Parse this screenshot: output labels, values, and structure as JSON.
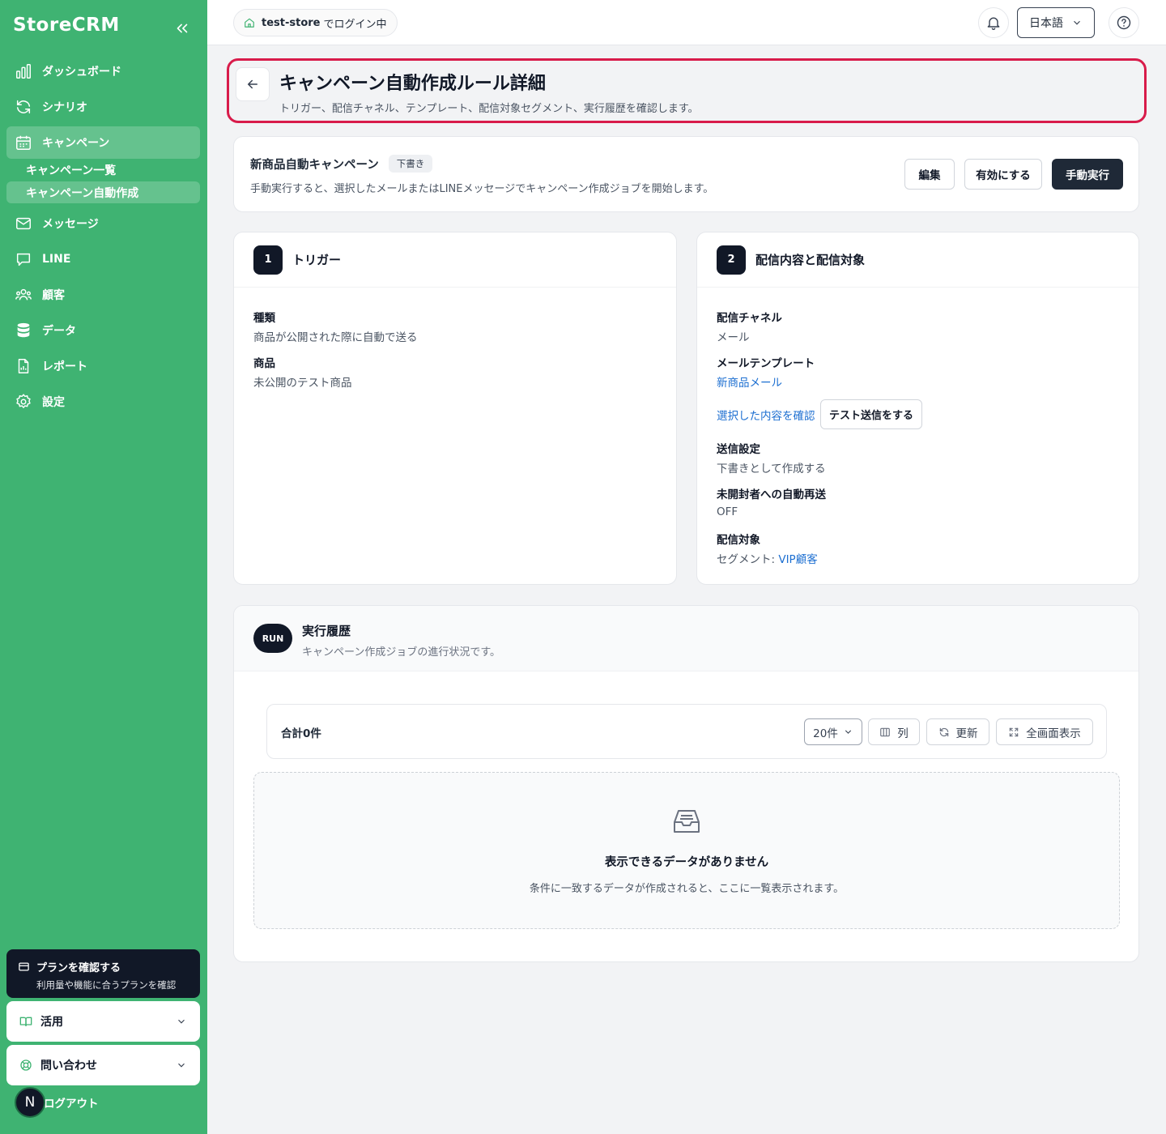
{
  "sidebar": {
    "logo": "StoreCRM",
    "items": [
      {
        "label": "ダッシュボード",
        "icon": "bar-chart-icon"
      },
      {
        "label": "シナリオ",
        "icon": "refresh-icon"
      },
      {
        "label": "キャンペーン",
        "icon": "calendar-icon",
        "active": true
      },
      {
        "label": "メッセージ",
        "icon": "mail-icon"
      },
      {
        "label": "LINE",
        "icon": "chat-icon"
      },
      {
        "label": "顧客",
        "icon": "users-icon"
      },
      {
        "label": "データ",
        "icon": "database-icon"
      },
      {
        "label": "レポート",
        "icon": "file-icon"
      },
      {
        "label": "設定",
        "icon": "gear-icon"
      }
    ],
    "sub_items": [
      {
        "label": "キャンペーン一覧"
      },
      {
        "label": "キャンペーン自動作成",
        "active": true
      }
    ],
    "plan_title": "プランを確認する",
    "plan_sub": "利用量や機能に合うプランを確認",
    "accordion_usage": "活用",
    "accordion_contact": "問い合わせ",
    "avatar_initial": "N",
    "logout": "ログアウト"
  },
  "topbar": {
    "store_name": "test-store",
    "store_suffix": "でログイン中",
    "language": "日本語"
  },
  "page": {
    "title": "キャンペーン自動作成ルール詳細",
    "subtitle": "トリガー、配信チャネル、テンプレート、配信対象セグメント、実行履歴を確認します。"
  },
  "campaign": {
    "name": "新商品自動キャンペーン",
    "status": "下書き",
    "description": "手動実行すると、選択したメールまたはLINEメッセージでキャンペーン作成ジョブを開始します。",
    "edit_label": "編集",
    "enable_label": "有効にする",
    "run_label": "手動実行"
  },
  "trigger": {
    "step": "1",
    "title": "トリガー",
    "type_label": "種類",
    "type_value": "商品が公開された際に自動で送る",
    "product_label": "商品",
    "product_value": "未公開のテスト商品"
  },
  "delivery": {
    "step": "2",
    "title": "配信内容と配信対象",
    "channel_label": "配信チャネル",
    "channel_value": "メール",
    "template_label": "メールテンプレート",
    "template_value": "新商品メール",
    "confirm_link": "選択した内容を確認",
    "test_send": "テスト送信をする",
    "send_setting_label": "送信設定",
    "send_setting_value": "下書きとして作成する",
    "resend_label": "未開封者への自動再送",
    "resend_value": "OFF",
    "target_label": "配信対象",
    "target_prefix": "セグメント: ",
    "target_value": "VIP顧客"
  },
  "history": {
    "badge": "RUN",
    "title": "実行履歴",
    "subtitle": "キャンペーン作成ジョブの進行状況です。",
    "total": "合計0件",
    "page_size": "20件",
    "columns_label": "列",
    "refresh_label": "更新",
    "fullscreen_label": "全画面表示",
    "empty_title": "表示できるデータがありません",
    "empty_sub": "条件に一致するデータが作成されると、ここに一覧表示されます。"
  }
}
